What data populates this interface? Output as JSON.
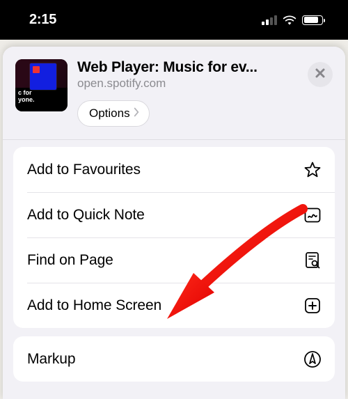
{
  "status": {
    "time": "2:15"
  },
  "sheet": {
    "title": "Web Player: Music for ev...",
    "url": "open.spotify.com",
    "options_label": "Options",
    "thumb_text_line1": "c for",
    "thumb_text_line2": "yone."
  },
  "actions_group1": [
    {
      "label": "Add to Favourites",
      "icon": "star-icon"
    },
    {
      "label": "Add to Quick Note",
      "icon": "quicknote-icon"
    },
    {
      "label": "Find on Page",
      "icon": "find-icon"
    },
    {
      "label": "Add to Home Screen",
      "icon": "add-home-icon"
    }
  ],
  "actions_group2": [
    {
      "label": "Markup",
      "icon": "markup-icon"
    }
  ],
  "annotation": {
    "color": "#ff1200"
  }
}
